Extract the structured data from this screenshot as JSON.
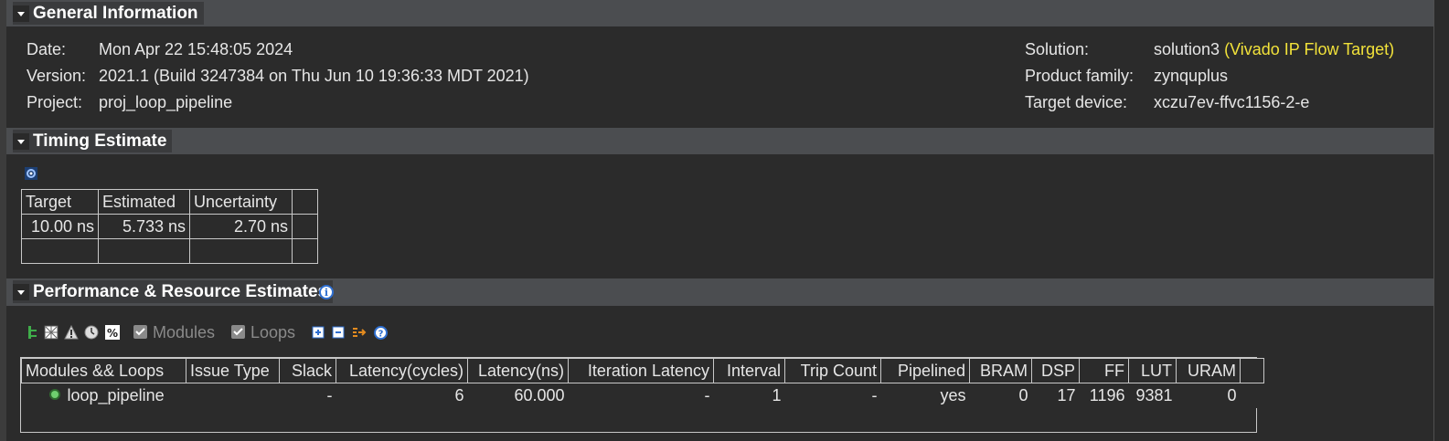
{
  "general": {
    "title": "General Information",
    "left": [
      {
        "label": "Date:",
        "value": "Mon Apr 22 15:48:05 2024"
      },
      {
        "label": "Version:",
        "value": "2021.1 (Build 3247384 on Thu Jun 10 19:36:33 MDT 2021)"
      },
      {
        "label": "Project:",
        "value": "proj_loop_pipeline"
      }
    ],
    "right": [
      {
        "label": "Solution:",
        "value": "solution3",
        "note": "(Vivado IP Flow Target)"
      },
      {
        "label": "Product family:",
        "value": "zynquplus"
      },
      {
        "label": "Target device:",
        "value": "xczu7ev-ffvc1156-2-e"
      }
    ]
  },
  "timing": {
    "title": "Timing Estimate",
    "headers": [
      "Target",
      "Estimated",
      "Uncertainty"
    ],
    "row": [
      "10.00 ns",
      "5.733 ns",
      "2.70 ns"
    ]
  },
  "perf": {
    "title": "Performance & Resource Estimates",
    "toolbar": {
      "modules_label": "Modules",
      "loops_label": "Loops"
    },
    "headers": [
      "Modules && Loops",
      "Issue Type",
      "Slack",
      "Latency(cycles)",
      "Latency(ns)",
      "Iteration Latency",
      "Interval",
      "Trip Count",
      "Pipelined",
      "BRAM",
      "DSP",
      "FF",
      "LUT",
      "URAM"
    ],
    "rows": [
      [
        "loop_pipeline",
        "",
        "-",
        "6",
        "60.000",
        "-",
        "1",
        "-",
        "yes",
        "0",
        "17",
        "1196",
        "9381",
        "0"
      ]
    ]
  },
  "colors": {
    "highlight": "#f2e23a",
    "section_bar": "#4b4d50",
    "background": "#2b2b2b"
  }
}
